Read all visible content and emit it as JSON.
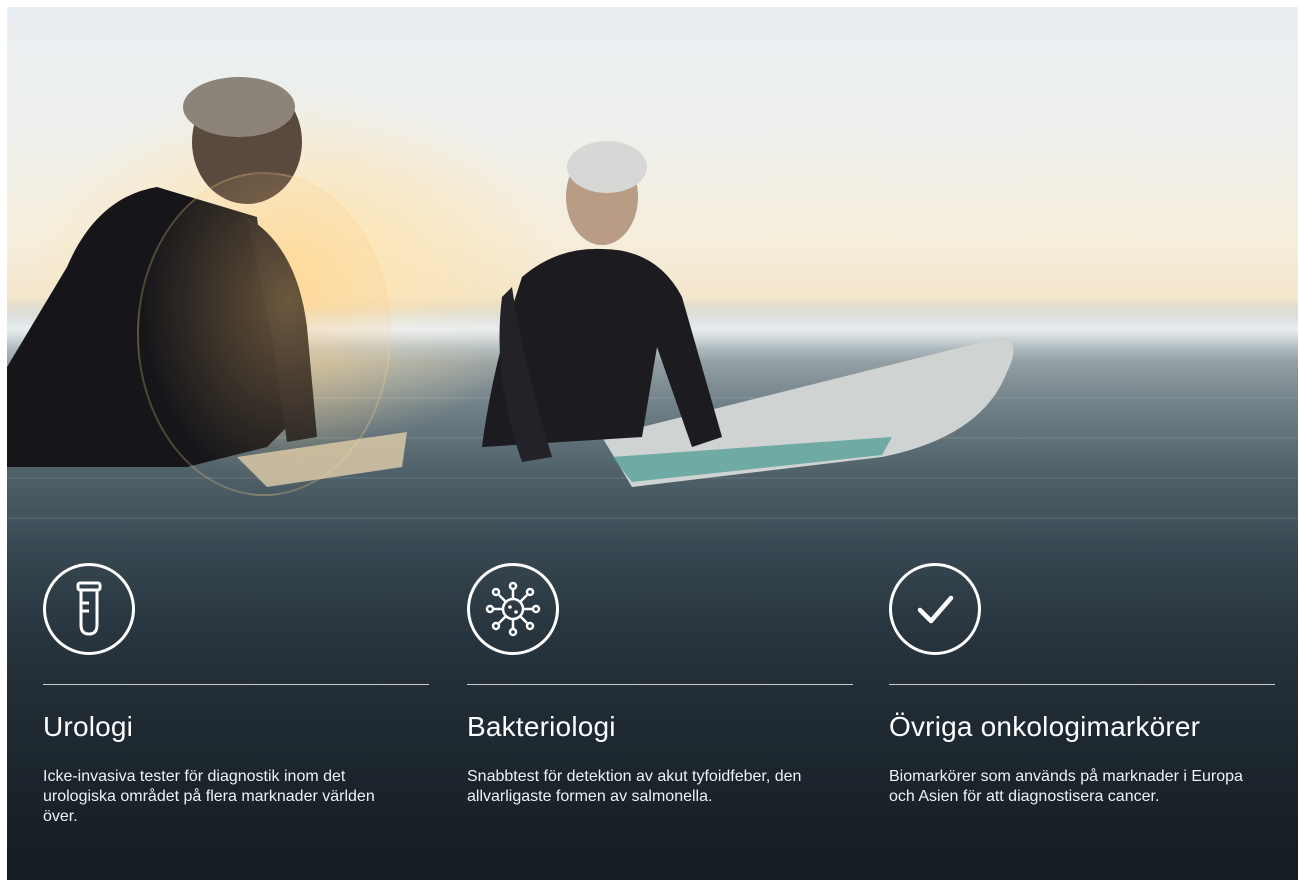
{
  "hero": {
    "image_description_icon": "photo-background"
  },
  "features": [
    {
      "icon": "test-tube-icon",
      "title": "Urologi",
      "description": "Icke-invasiva tester för diagnostik inom det urologiska området på flera marknader världen över."
    },
    {
      "icon": "virus-icon",
      "title": "Bakteriologi",
      "description": "Snabbtest för detektion av akut tyfoidfeber, den allvarligaste formen av salmonella."
    },
    {
      "icon": "checkmark-icon",
      "title": "Övriga onkologimarkörer",
      "description": "Biomarkörer som används på marknader i Europa och Asien för att diagnostisera cancer."
    }
  ],
  "colors": {
    "text": "#ffffff",
    "divider": "#ffffffbf"
  }
}
